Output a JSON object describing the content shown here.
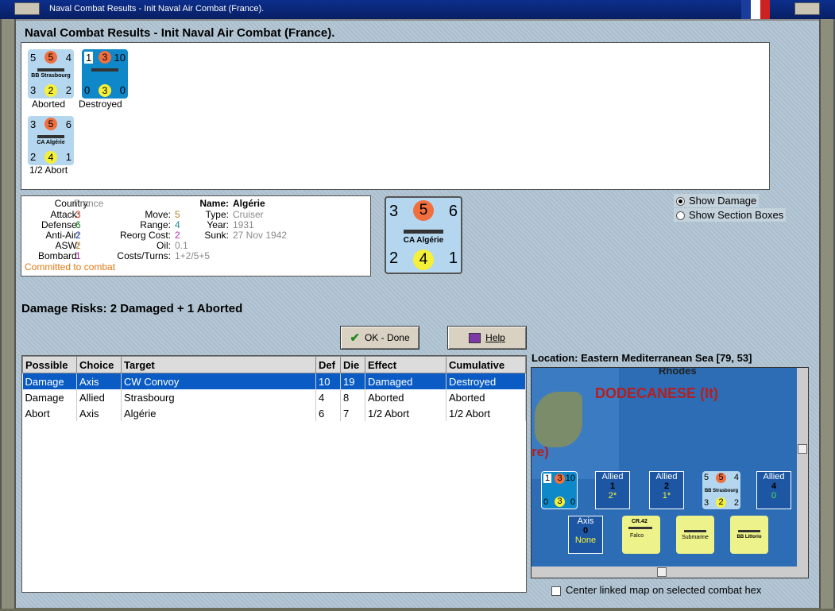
{
  "window": {
    "title": "Naval Combat Results - Init Naval Air Combat (France)."
  },
  "heading": "Naval Combat Results - Init Naval Air Combat (France).",
  "results_units": [
    {
      "tl": "5",
      "top": "5",
      "tr": "4",
      "name": "BB Strasbourg",
      "bl": "3",
      "bot": "2",
      "br": "2",
      "label": "Aborted",
      "style": "light"
    },
    {
      "tl": "1",
      "top": "3",
      "tr": "10",
      "name": "",
      "bl": "0",
      "bot": "3",
      "br": "0",
      "label": "Destroyed",
      "style": "dark"
    },
    {
      "tl": "3",
      "top": "5",
      "tr": "6",
      "name": "CA Algérie",
      "bl": "2",
      "bot": "4",
      "br": "1",
      "label": "1/2 Abort",
      "style": "light"
    }
  ],
  "info": {
    "country_k": "Country:",
    "country_v": "France",
    "attack_k": "Attack:",
    "attack_v": "3",
    "defense_k": "Defense:",
    "defense_v": "6",
    "antiair_k": "Anti-Air:",
    "antiair_v": "2",
    "asw_k": "ASW:",
    "asw_v": "2",
    "bombard_k": "Bombard:",
    "bombard_v": "1",
    "committed": "Committed to combat",
    "move_k": "Move:",
    "move_v": "5",
    "range_k": "Range:",
    "range_v": "4",
    "reorg_k": "Reorg Cost:",
    "reorg_v": "2",
    "oil_k": "Oil:",
    "oil_v": "0.1",
    "costs_k": "Costs/Turns:",
    "costs_v": "1+2/5+5",
    "name_k": "Name:",
    "name_v": "Algérie",
    "type_k": "Type:",
    "type_v": "Cruiser",
    "year_k": "Year:",
    "year_v": "1931",
    "sunk_k": "Sunk:",
    "sunk_v": "27 Nov 1942"
  },
  "big_unit": {
    "tl": "3",
    "top": "5",
    "tr": "6",
    "name": "CA Algérie",
    "bl": "2",
    "bot": "4",
    "br": "1"
  },
  "radios": {
    "show_damage": "Show Damage",
    "show_sections": "Show Section Boxes"
  },
  "damage_risks": "Damage Risks:  2 Damaged + 1 Aborted",
  "buttons": {
    "ok": "OK - Done",
    "help": "Help"
  },
  "table": {
    "headers": [
      "Possible",
      "Choice",
      "Target",
      "Def",
      "Die",
      "Effect",
      "Cumulative"
    ],
    "rows": [
      [
        "Damage",
        "Axis",
        "CW Convoy",
        "10",
        "19",
        "Damaged",
        "Destroyed"
      ],
      [
        "Damage",
        "Allied",
        "Strasbourg",
        "4",
        "8",
        "Aborted",
        "Aborted"
      ],
      [
        "Abort",
        "Axis",
        "Algérie",
        "6",
        "7",
        "1/2 Abort",
        "1/2 Abort"
      ]
    ]
  },
  "location": "Location:  Eastern Mediterranean Sea [79, 53]",
  "map": {
    "rhodes": "Rhodes",
    "dodecanese": "DODECANESE (It)",
    "re": "re)",
    "allied1": {
      "t": "Allied",
      "n": "1",
      "s": "2*"
    },
    "allied2": {
      "t": "Allied",
      "n": "2",
      "s": "1*"
    },
    "allied3": {
      "t": "Allied",
      "n": "4",
      "s": "0"
    },
    "axis": {
      "t": "Axis",
      "n": "0",
      "s": "None"
    },
    "cr42": "CR.42",
    "falco": "Falco",
    "submarine": "Submarine",
    "littorio": "BB Littorio"
  },
  "center_check": "Center linked map on selected combat hex"
}
